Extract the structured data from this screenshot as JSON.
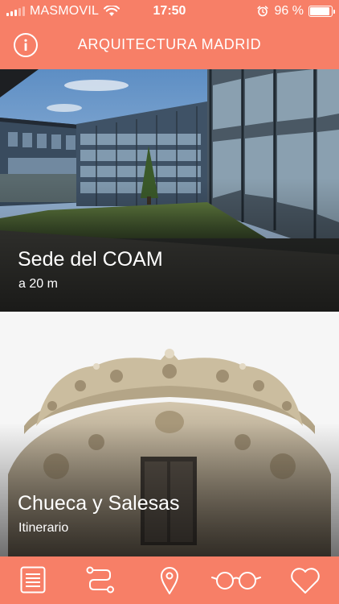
{
  "status_bar": {
    "carrier": "MASMOVIL",
    "time": "17:50",
    "battery_percent": "96 %",
    "battery_level": 0.96,
    "signal_bars_active": 3,
    "signal_bars_total": 5
  },
  "header": {
    "title": "ARQUITECTURA MADRID",
    "info_icon": "info-icon"
  },
  "cards": [
    {
      "title": "Sede del COAM",
      "subtitle": "a 20 m"
    },
    {
      "title": "Chueca y Salesas",
      "subtitle": "Itinerario"
    }
  ],
  "tab_bar": {
    "items": [
      {
        "icon": "list-icon"
      },
      {
        "icon": "route-icon"
      },
      {
        "icon": "map-pin-icon"
      },
      {
        "icon": "glasses-icon"
      },
      {
        "icon": "heart-icon"
      }
    ]
  },
  "colors": {
    "accent": "#f77f67",
    "on_accent": "#ffffff"
  }
}
